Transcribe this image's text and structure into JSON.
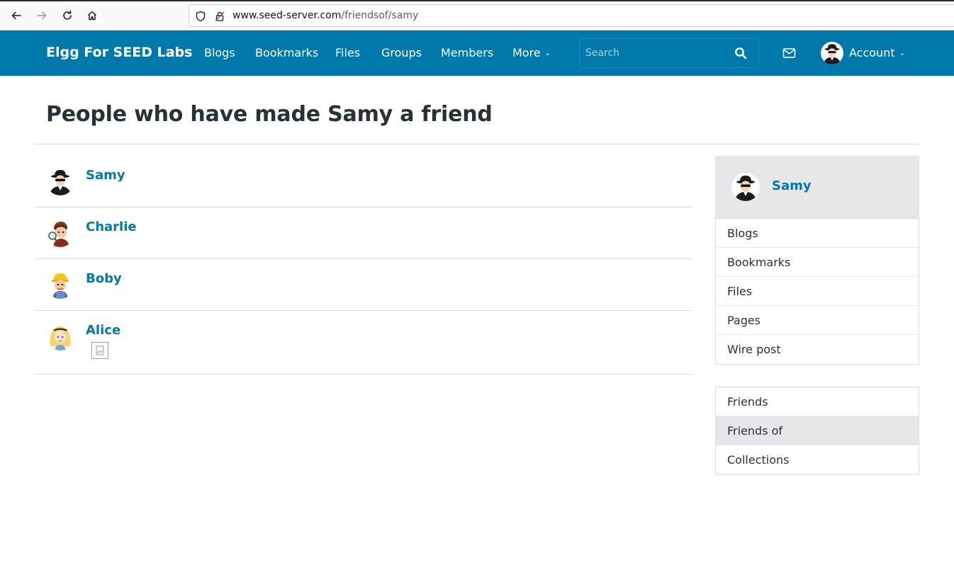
{
  "browser": {
    "url_host": "www.seed-server.com",
    "url_path": "/friendsof/samy"
  },
  "topbar": {
    "site_name": "Elgg For SEED Labs",
    "menu": [
      "Blogs",
      "Bookmarks",
      "Files",
      "Groups",
      "Members",
      "More"
    ],
    "search_placeholder": "Search",
    "account_label": "Account"
  },
  "page": {
    "title": "People who have made Samy a friend"
  },
  "friends": [
    {
      "name": "Samy"
    },
    {
      "name": "Charlie"
    },
    {
      "name": "Boby"
    },
    {
      "name": "Alice"
    }
  ],
  "sidebar": {
    "owner_name": "Samy",
    "content_menu": [
      "Blogs",
      "Bookmarks",
      "Files",
      "Pages",
      "Wire post"
    ],
    "friends_menu": [
      "Friends",
      "Friends of",
      "Collections"
    ],
    "active_item": "Friends of"
  },
  "colors": {
    "topbar": "#0078ac",
    "link": "#0078ac",
    "sidebar_highlight": "#e6e6ea"
  }
}
